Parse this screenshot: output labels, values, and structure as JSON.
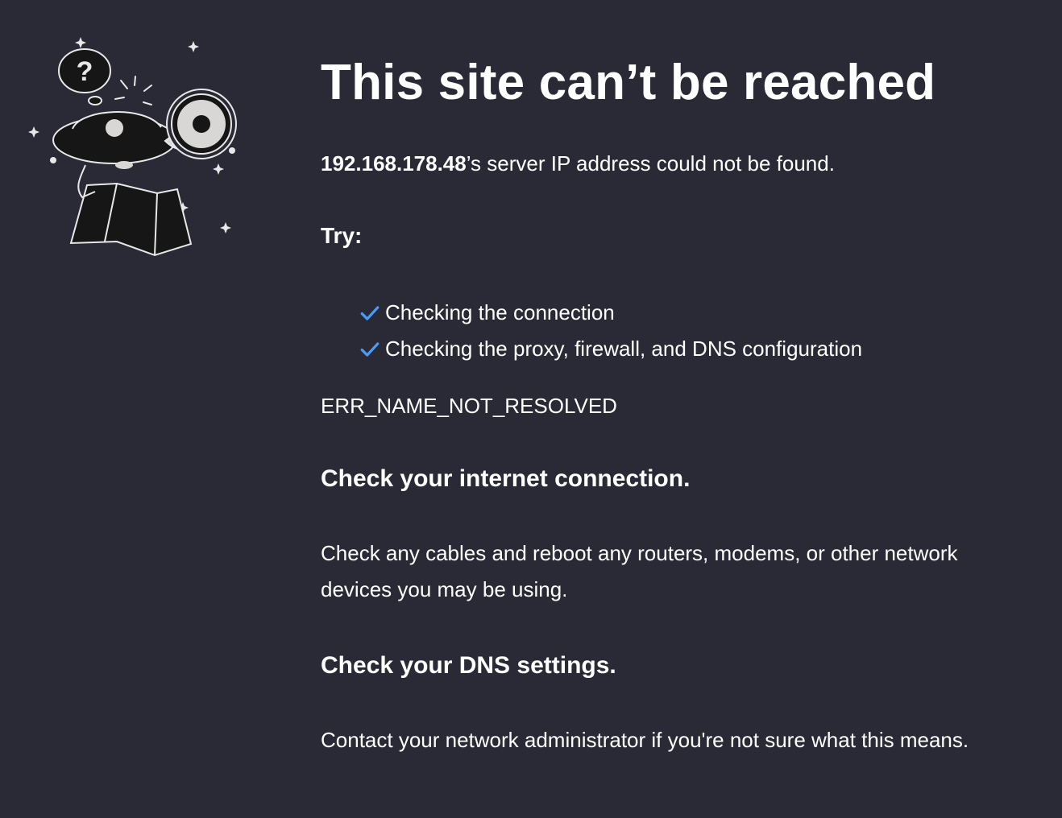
{
  "page": {
    "title": "This site can’t be reached",
    "host": "192.168.178.48",
    "summary_suffix": "’s server IP address could not be found.",
    "try_label": "Try:",
    "suggestions": [
      {
        "label": "Checking the connection",
        "icon": "check-icon"
      },
      {
        "label": "Checking the proxy, firewall, and DNS configuration",
        "icon": "check-icon"
      }
    ],
    "error_code": "ERR_NAME_NOT_RESOLVED",
    "sections": [
      {
        "heading": "Check your internet connection.",
        "body": "Check any cables and reboot any routers, modems, or other network devices you may be using."
      },
      {
        "heading": "Check your DNS settings.",
        "body": "Contact your network administrator if you're not sure what this means."
      }
    ]
  },
  "illustration": {
    "icon": "explorer-with-binoculars-icon",
    "bubble_text": "?"
  },
  "colors": {
    "background": "#292a36",
    "text": "#ffffff",
    "check": "#4a9bf5",
    "illustration_fill": "#161616",
    "illustration_light": "#d9d6d6"
  }
}
